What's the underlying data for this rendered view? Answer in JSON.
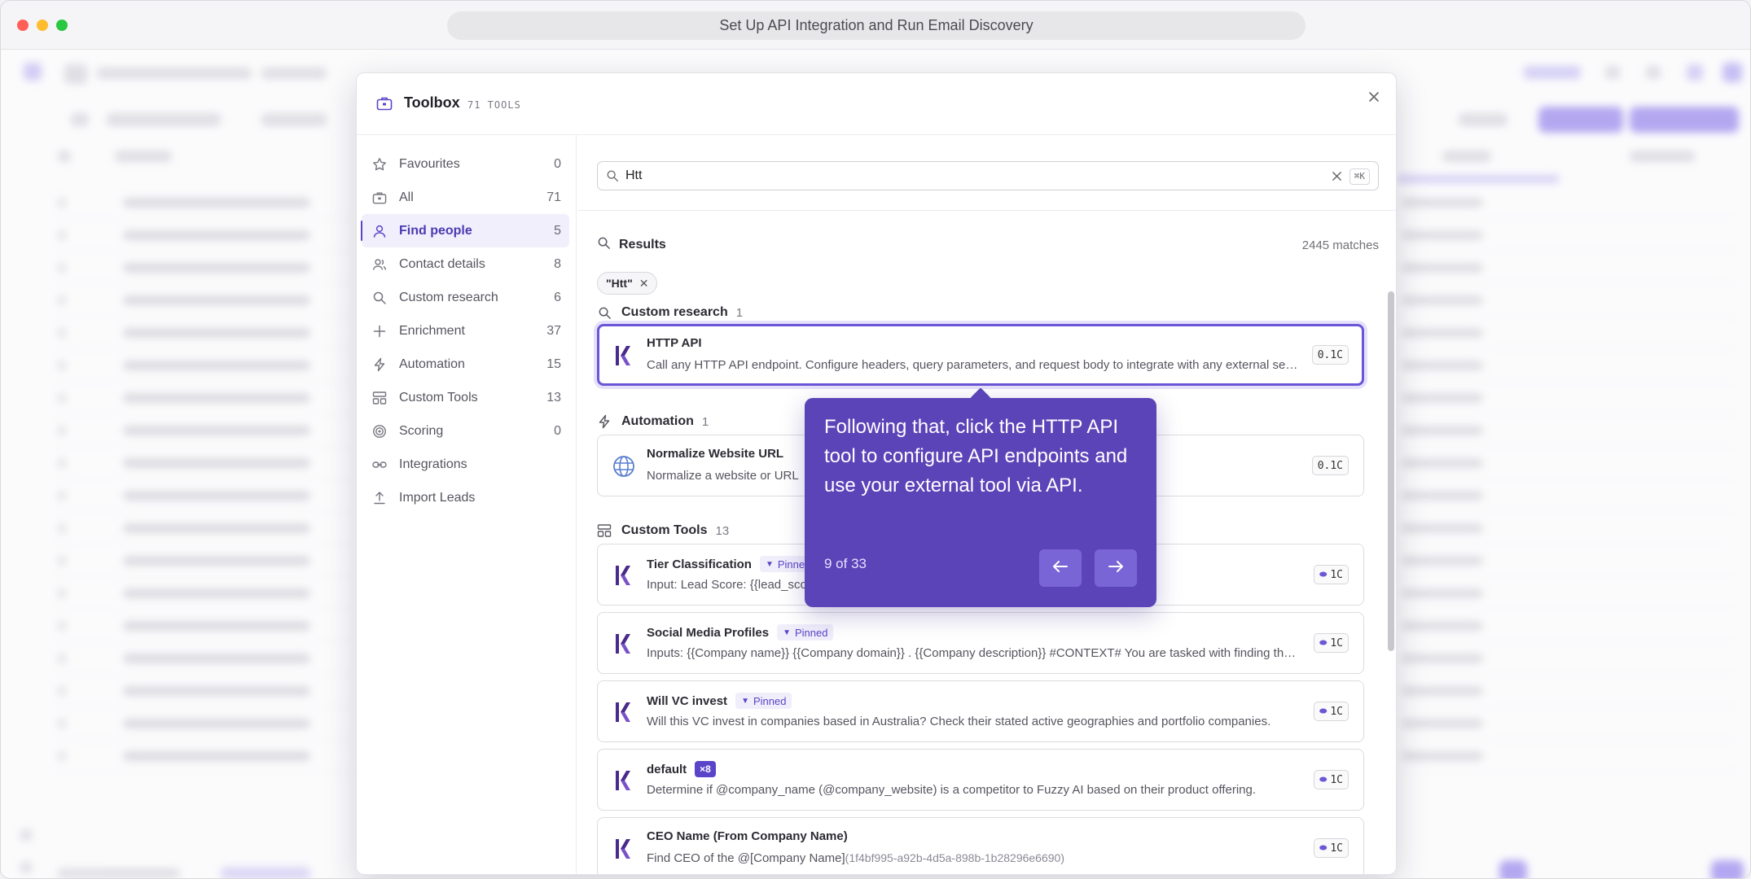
{
  "window": {
    "url_title": "Set Up API Integration and Run Email Discovery"
  },
  "colors": {
    "accent": "#5a45c8",
    "tooltip_bg": "#5b44b8",
    "selected_border": "#6a56d6"
  },
  "modal": {
    "title": "Toolbox",
    "count_label": "71 TOOLS",
    "close_icon": "close-icon"
  },
  "sidebar": {
    "items": [
      {
        "label": "Favourites",
        "count": "0",
        "icon": "star-icon"
      },
      {
        "label": "All",
        "count": "71",
        "icon": "toolbox-icon"
      },
      {
        "label": "Find people",
        "count": "5",
        "icon": "person-icon"
      },
      {
        "label": "Contact details",
        "count": "8",
        "icon": "contacts-icon"
      },
      {
        "label": "Custom research",
        "count": "6",
        "icon": "search-icon"
      },
      {
        "label": "Enrichment",
        "count": "37",
        "icon": "plus-icon"
      },
      {
        "label": "Automation",
        "count": "15",
        "icon": "bolt-icon"
      },
      {
        "label": "Custom Tools",
        "count": "13",
        "icon": "custom-tools-icon"
      },
      {
        "label": "Scoring",
        "count": "0",
        "icon": "target-icon"
      },
      {
        "label": "Integrations",
        "count": "",
        "icon": "link-icon"
      },
      {
        "label": "Import Leads",
        "count": "",
        "icon": "upload-icon"
      }
    ],
    "active_index": 2
  },
  "search": {
    "value": "Htt",
    "shortcut": "⌘K"
  },
  "results": {
    "label": "Results",
    "matches": "2445 matches",
    "chip": "\"Htt\""
  },
  "sections": {
    "custom_research": {
      "label": "Custom research",
      "count": "1"
    },
    "automation": {
      "label": "Automation",
      "count": "1"
    },
    "custom_tools": {
      "label": "Custom Tools",
      "count": "13"
    }
  },
  "tools": {
    "http_api": {
      "name": "HTTP API",
      "desc": "Call any HTTP API endpoint. Configure headers, query parameters, and request body to integrate with any external service.",
      "cost": "0.1C"
    },
    "normalize": {
      "name": "Normalize Website URL",
      "desc": "Normalize a website or URL",
      "cost": "0.1C"
    },
    "tier": {
      "name": "Tier Classification",
      "badge": "Pinned",
      "desc": "Input: Lead Score: {{lead_score}} You are an expert sales operations analyst...",
      "cost": "1C"
    },
    "social": {
      "name": "Social Media Profiles",
      "badge": "Pinned",
      "desc": "Inputs: {{Company name}} {{Company domain}} . {{Company description}} #CONTEXT# You are tasked with finding the social media profiles.",
      "cost": "1C"
    },
    "vc": {
      "name": "Will VC invest",
      "badge": "Pinned",
      "desc": "Will this VC invest in companies based in Australia? Check their stated active geographies and portfolio companies.",
      "cost": "1C"
    },
    "default": {
      "name": "default",
      "badge": "×8",
      "desc": "Determine if @company_name (@company_website) is a competitor to Fuzzy AI based on their product offering.",
      "cost": "1C"
    },
    "ceo": {
      "name": "CEO Name (From Company Name)",
      "desc_prefix": "Find CEO of the @[Company Name]",
      "desc_ref": "(1f4bf995-a92b-4d5a-898b-1b28296e6690)",
      "cost": "1C"
    }
  },
  "tooltip": {
    "text": "Following that, click the HTTP API tool to configure API endpoints and use your external tool via API.",
    "counter": "9 of 33"
  }
}
